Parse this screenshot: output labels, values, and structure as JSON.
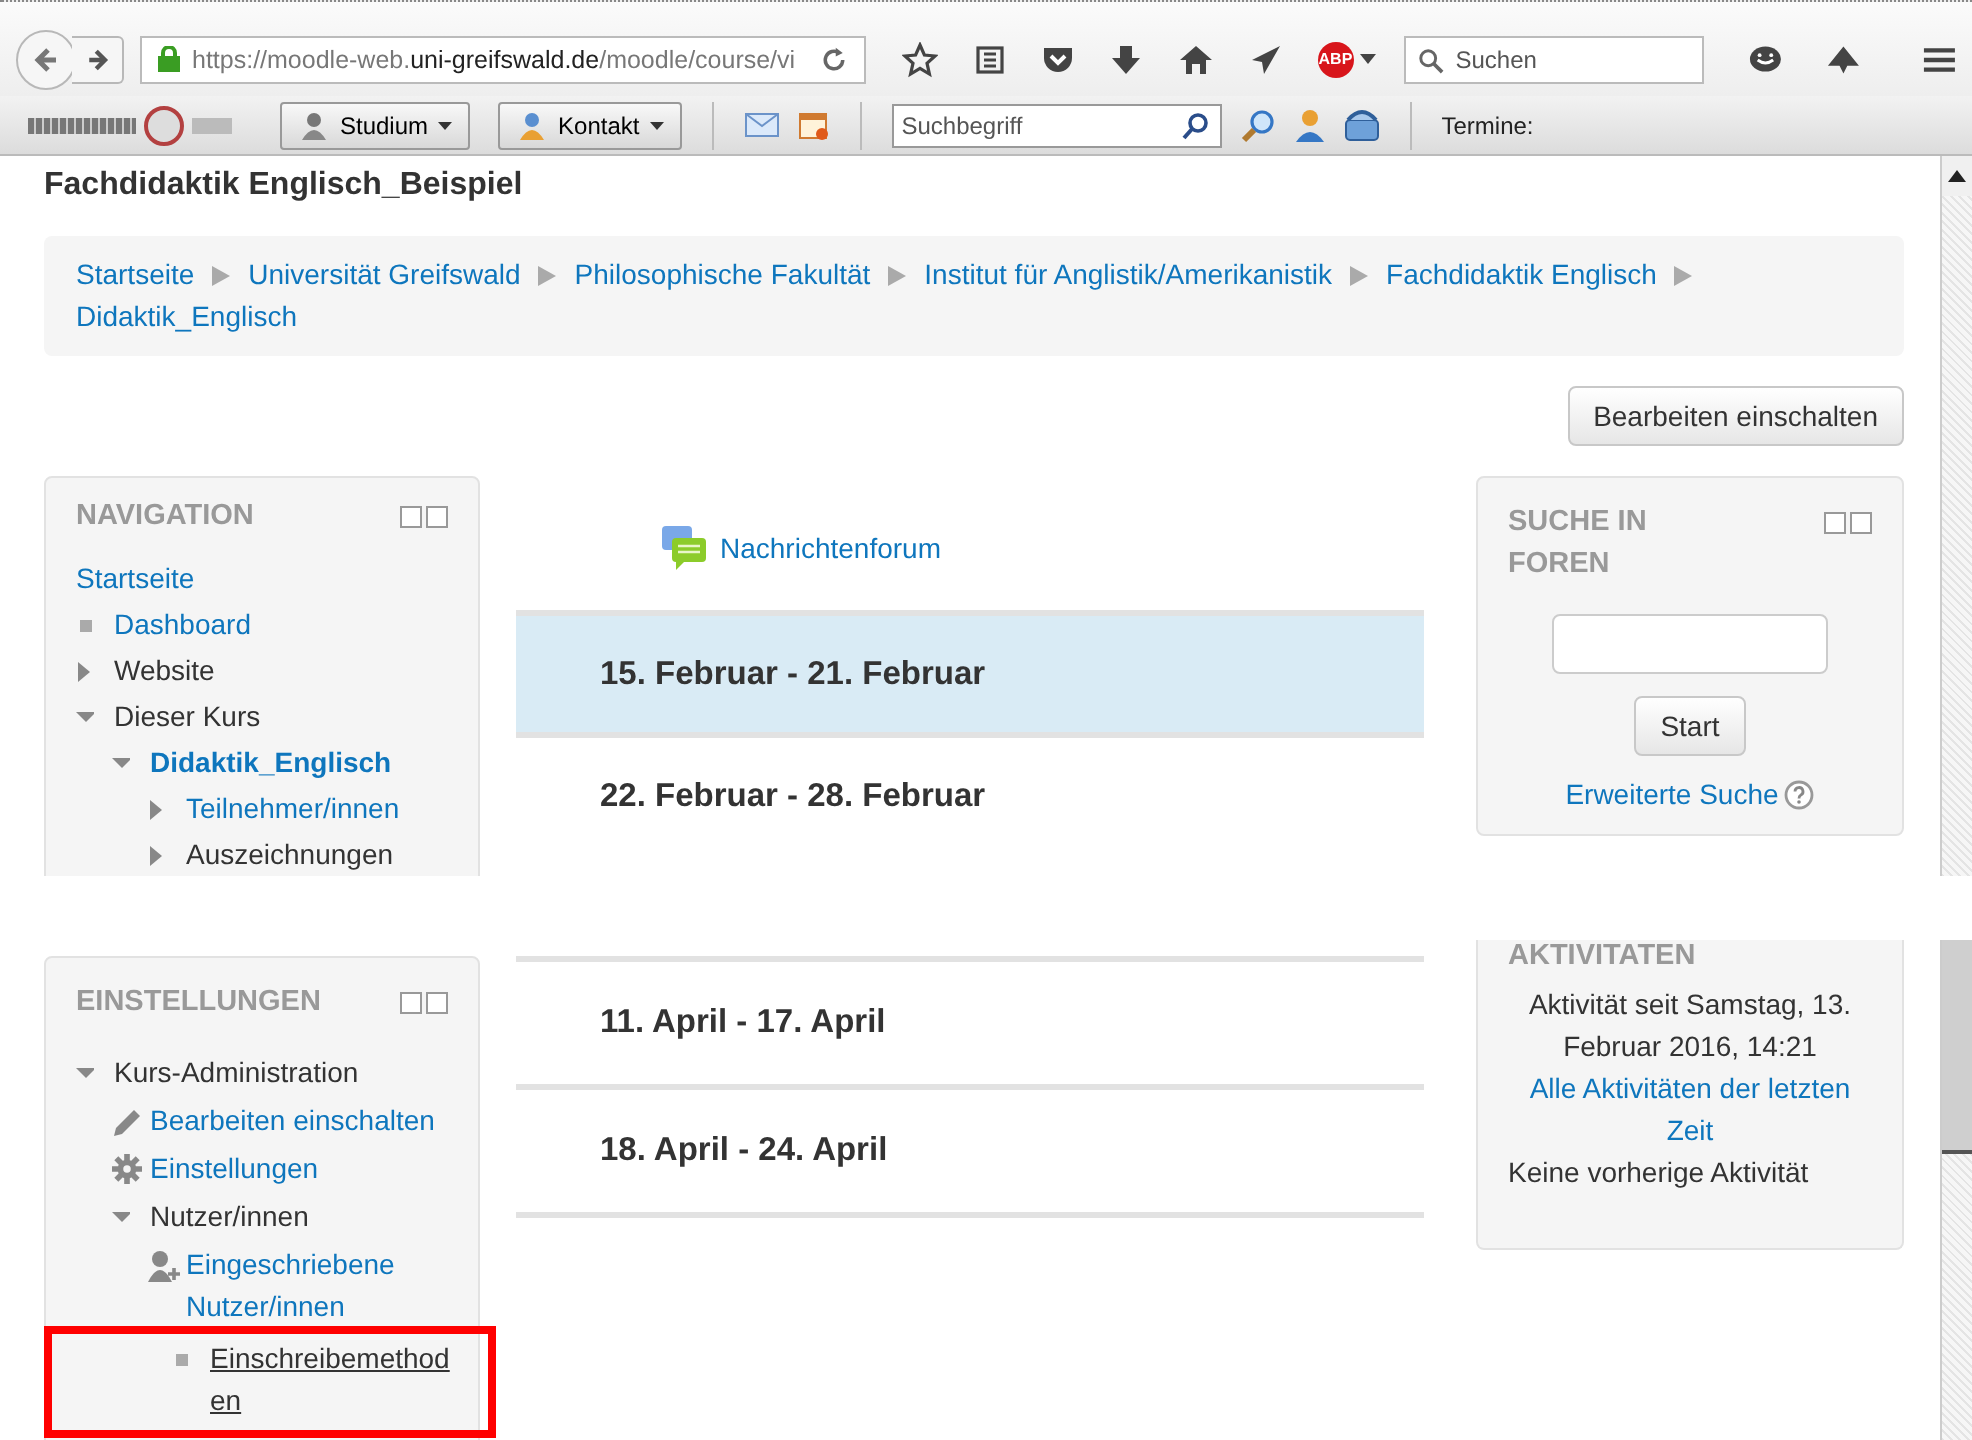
{
  "browser": {
    "url": {
      "scheme": "https://moodle-web.",
      "domain": "uni-greifswald.de",
      "path": "/moodle/course/vi"
    },
    "search_placeholder": "Suchen",
    "adblock_label": "ABP"
  },
  "extension_bar": {
    "buttons": [
      {
        "label": "Studium"
      },
      {
        "label": "Kontakt"
      }
    ],
    "search_placeholder": "Suchbegriff",
    "termine": "Termine:"
  },
  "page": {
    "title": "Fachdidaktik Englisch_Beispiel",
    "breadcrumb": [
      "Startseite",
      "Universität Greifswald",
      "Philosophische Fakultät",
      "Institut für Anglistik/Amerikanistik",
      "Fachdidaktik Englisch",
      "Didaktik_Englisch"
    ],
    "edit_button": "Bearbeiten einschalten"
  },
  "navigation": {
    "title": "NAVIGATION",
    "items": [
      {
        "label": "Startseite",
        "kind": "link",
        "children": [
          {
            "label": "Dashboard",
            "kind": "bullet_link"
          },
          {
            "label": "Website",
            "kind": "toggle_text",
            "expanded": false
          },
          {
            "label": "Dieser Kurs",
            "kind": "toggle_text",
            "expanded": true,
            "children": [
              {
                "label": "Didaktik_Englisch",
                "kind": "toggle_current",
                "expanded": true,
                "children": [
                  {
                    "label": "Teilnehmer/innen",
                    "kind": "toggle_link",
                    "expanded": false
                  },
                  {
                    "label": "Auszeichnungen",
                    "kind": "toggle_text",
                    "expanded": false
                  }
                ]
              }
            ]
          }
        ]
      }
    ]
  },
  "center_top": {
    "forum_link": "Nachrichtenforum",
    "sections": [
      {
        "title": "15. Februar - 21. Februar",
        "selected": true
      },
      {
        "title": "22. Februar - 28. Februar",
        "selected": false
      }
    ]
  },
  "forum_search": {
    "title": "SUCHE IN FOREN",
    "button": "Start",
    "advanced_link": "Erweiterte Suche"
  },
  "settings": {
    "title": "EINSTELLUNGEN",
    "items": [
      {
        "label": "Kurs-Administration",
        "kind": "toggle_text",
        "expanded": true,
        "children": [
          {
            "label": "Bearbeiten einschalten",
            "kind": "pencil_link"
          },
          {
            "label": "Einstellungen",
            "kind": "gear_link"
          },
          {
            "label": "Nutzer/innen",
            "kind": "toggle_text",
            "expanded": true,
            "children": [
              {
                "label": "Eingeschriebene Nutzer/innen",
                "kind": "user_link"
              },
              {
                "label": "Einschreibemethoden",
                "kind": "bullet_current",
                "highlighted": true
              }
            ]
          }
        ]
      }
    ]
  },
  "center_bottom": {
    "sections": [
      {
        "title": "11. April - 17. April",
        "selected": false
      },
      {
        "title": "18. April - 24. April",
        "selected": false
      }
    ]
  },
  "recent_activity": {
    "title": "AKTIVITATEN",
    "since": "Aktivität seit Samstag, 13. Februar 2016, 14:21",
    "all_link": "Alle Aktivitäten der letzten Zeit",
    "none_text": "Keine vorherige Aktivität"
  }
}
